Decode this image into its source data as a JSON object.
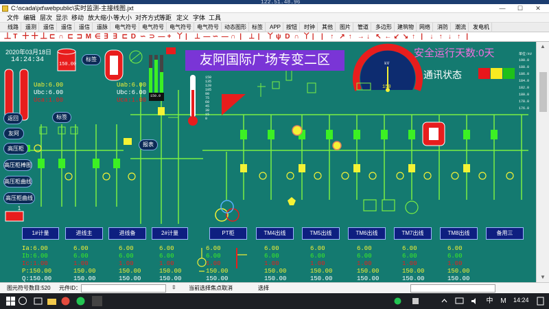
{
  "remote": {
    "host": "122.51.48.96"
  },
  "window": {
    "title": "C:\\scada\\jxt\\webpublic\\实时监测-主接线图.jxt",
    "min": "—",
    "max": "☐",
    "close": "✕"
  },
  "menu": [
    "文件",
    "编辑",
    "层次",
    "显示",
    "移动",
    "放大缩小",
    "等大小",
    "对齐方式",
    "等距",
    "定义",
    "字体",
    "工具"
  ],
  "tabs": [
    "线路",
    "遥测",
    "遥信",
    "遥信",
    "遥信",
    "遥脉",
    "电气符号",
    "电气符号",
    "电气符号",
    "电气符号",
    "动态图形",
    "标签",
    "APP",
    "按钮",
    "时钟",
    "其他",
    "图片",
    "管道",
    "多边形",
    "建筑物",
    "网络",
    "消防",
    "潮流",
    "发电机"
  ],
  "symbols": [
    "丄",
    "T",
    "十",
    "十",
    "丄",
    "⊏",
    "∩",
    "⊏",
    "⊐",
    "M",
    "∈",
    "∃",
    "∃",
    "⊏",
    "D",
    "∽",
    "⊃",
    "—",
    "+",
    "丫",
    "|",
    "⊥",
    "—",
    "∽",
    "—",
    "∩",
    "|",
    "⊥",
    "|",
    "丫",
    "ψ",
    "D",
    "∩",
    "丫",
    "|",
    "|",
    "↑",
    "↗",
    "↑",
    "→",
    "↓",
    "↖",
    "←",
    "↙",
    "↘",
    "↑",
    "|",
    "↓",
    "↑",
    "↓",
    "↑",
    "|"
  ],
  "header": {
    "date": "2020年03月18日",
    "time": "14:24:34",
    "banner": "友阿国际广场专变二区",
    "safety": "安全运行天数:0天",
    "comm_label": "通讯状态",
    "comm_colors": [
      "#e8161b",
      "#f7ea21",
      "#1fc01a"
    ]
  },
  "left_meas": [
    "Uab:6.00",
    "Ubc:6.00",
    "Uca:1.00"
  ],
  "mid_meas": [
    "Uab:6.00",
    "Ubc:6.00",
    "Uca:1.00"
  ],
  "status_colors": {
    "green": "#3cf024",
    "yellow": "#f4f235",
    "red": "#e81d1d",
    "white": "#ffffff",
    "busbar": "#7bf043"
  },
  "pills": {
    "tank": "150.00",
    "label1": "标签",
    "label2": "标签",
    "report": "报表",
    "gauge_val": "150",
    "bar_bottom": "150.0"
  },
  "side_buttons": [
    "返回",
    "友阿",
    "高压柜",
    "高压柜棒图",
    "高压柜曲线",
    "高压柜曲线1"
  ],
  "bar_numbers": [
    "150",
    "135",
    "120",
    "105",
    "90",
    "75",
    "60",
    "45",
    "30",
    "15",
    "0"
  ],
  "scale_numbers": [
    "单位:kV",
    "190.0",
    "188.0",
    "186.0",
    "184.0",
    "182.0",
    "180.0",
    "178.0",
    "176.0"
  ],
  "gauge": {
    "label": "kV"
  },
  "feeders": [
    "1#计量",
    "进线主",
    "进线备",
    "2#计量",
    "PT柜",
    "TM4出线",
    "TM5出线",
    "TM6出线",
    "TM7出线",
    "TM8出线",
    "备用三"
  ],
  "rows": [
    {
      "label": "Ia:6.00",
      "values": [
        "6.00",
        "6.00",
        "6.00",
        "6.00",
        "6.00",
        "6.00",
        "6.00",
        "6.00",
        "6.00"
      ],
      "color": "#f4f235"
    },
    {
      "label": "Ib:6.00",
      "values": [
        "6.00",
        "6.00",
        "6.00",
        "6.00",
        "6.00",
        "6.00",
        "6.00",
        "6.00",
        "6.00"
      ],
      "color": "#3cf024"
    },
    {
      "label": "Ic:1.00",
      "values": [
        "1.00",
        "1.00",
        "1.00",
        "1.00",
        "1.00",
        "1.00",
        "1.00",
        "1.00",
        "1.00"
      ],
      "color": "#e81d1d"
    },
    {
      "label": "P:150.00",
      "values": [
        "150.00",
        "150.00",
        "150.00",
        "150.00",
        "150.00",
        "150.00",
        "150.00",
        "150.00",
        "150.00"
      ],
      "color": "#f4f235"
    },
    {
      "label": "Q:150.00",
      "values": [
        "150.00",
        "150.00",
        "150.00",
        "150.00",
        "150.00",
        "150.00",
        "150.00",
        "150.00",
        "150.00"
      ],
      "color": "#ffffff"
    }
  ],
  "statusbar": {
    "count": "图元符号数目:520",
    "elem_id": "元件ID：",
    "hint": "当前选择焦点取消",
    "select": "选择"
  },
  "taskbar": {
    "time": "14:24"
  }
}
